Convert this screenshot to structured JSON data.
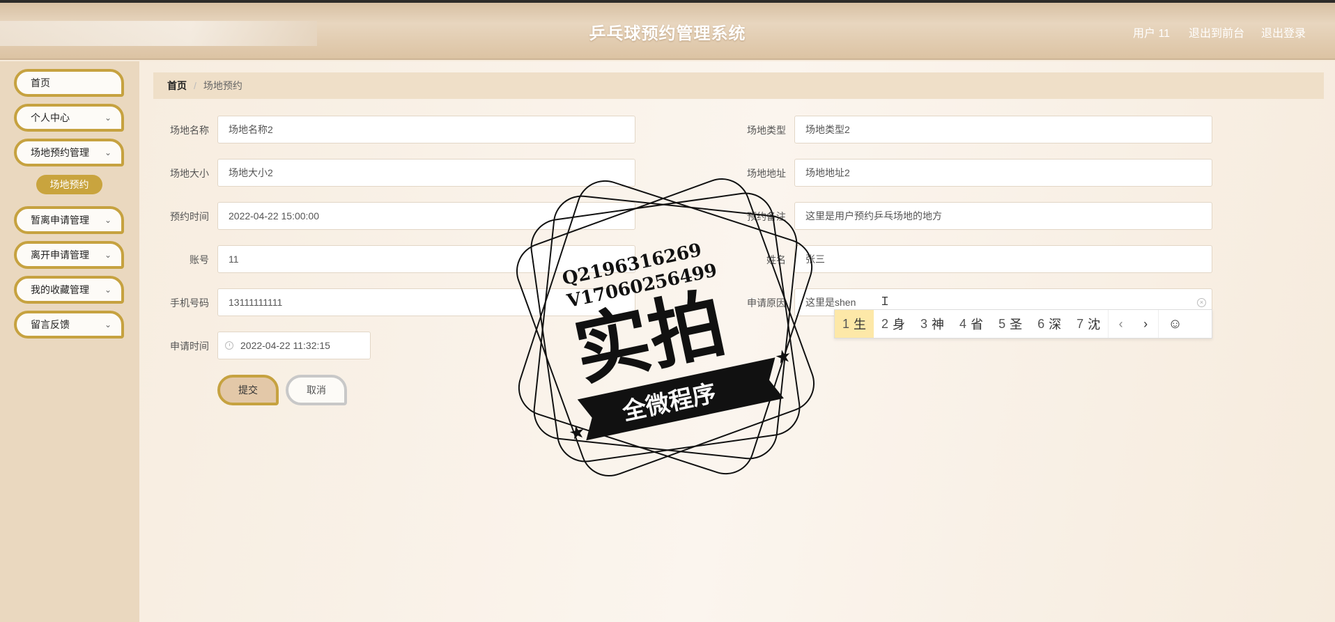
{
  "app": {
    "title": "乒乓球预约管理系统",
    "user": "用户 11",
    "exit_front": "退出到前台",
    "logout": "退出登录"
  },
  "sidebar": {
    "items": [
      {
        "label": "首页"
      },
      {
        "label": "个人中心"
      },
      {
        "label": "场地预约管理"
      },
      {
        "label": "暂离申请管理"
      },
      {
        "label": "离开申请管理"
      },
      {
        "label": "我的收藏管理"
      },
      {
        "label": "留言反馈"
      }
    ],
    "active_sub": "场地预约"
  },
  "breadcrumb": {
    "home": "首页",
    "sep": "/",
    "current": "场地预约"
  },
  "form": {
    "venue_name": {
      "label": "场地名称",
      "value": "场地名称2"
    },
    "venue_type": {
      "label": "场地类型",
      "value": "场地类型2"
    },
    "venue_size": {
      "label": "场地大小",
      "value": "场地大小2"
    },
    "venue_address": {
      "label": "场地地址",
      "value": "场地地址2"
    },
    "booking_time": {
      "label": "预约时间",
      "value": "2022-04-22 15:00:00"
    },
    "booking_remark": {
      "label": "预约备注",
      "value": "这里是用户预约乒乓场地的地方"
    },
    "account": {
      "label": "账号",
      "value": "11"
    },
    "name": {
      "label": "姓名",
      "value": "张三"
    },
    "phone": {
      "label": "手机号码",
      "value": "13111111111"
    },
    "reason": {
      "label": "申请原因",
      "value": "这里是shen"
    },
    "apply_time": {
      "label": "申请时间",
      "value": "2022-04-22 11:32:15"
    },
    "submit": "提交",
    "cancel": "取消"
  },
  "ime": {
    "candidates": [
      {
        "num": "1",
        "char": "生"
      },
      {
        "num": "2",
        "char": "身"
      },
      {
        "num": "3",
        "char": "神"
      },
      {
        "num": "4",
        "char": "省"
      },
      {
        "num": "5",
        "char": "圣"
      },
      {
        "num": "6",
        "char": "深"
      },
      {
        "num": "7",
        "char": "沈"
      }
    ],
    "prev": "‹",
    "next": "›",
    "emoji": "☺"
  },
  "watermark": {
    "line1": "Q2196316269",
    "line2": "V17060256499",
    "main": "实拍",
    "banner": "全微程序"
  },
  "colors": {
    "accent": "#c6a240",
    "sidebar_bg": "#ead8bf",
    "ime_selected": "#fde8a8"
  }
}
